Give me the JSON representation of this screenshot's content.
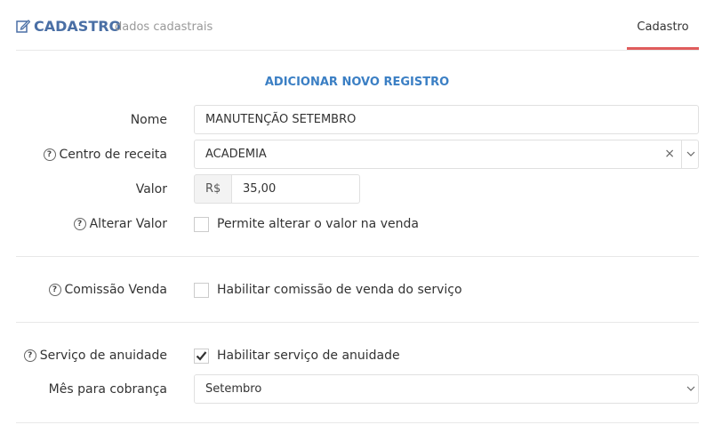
{
  "header": {
    "icon": "edit-icon",
    "title": "CADASTRO",
    "subtitle": "dados cadastrais",
    "tab_label": "Cadastro"
  },
  "colors": {
    "title": "#4a6fa5",
    "section_title": "#3b7fc4",
    "tab_underline": "#e05c5c"
  },
  "form": {
    "section_title": "ADICIONAR NOVO REGISTRO",
    "nome": {
      "label": "Nome",
      "value": "MANUTENÇÃO SETEMBRO"
    },
    "centro_receita": {
      "label": "Centro de receita",
      "value": "ACADEMIA",
      "clear": "×"
    },
    "valor": {
      "label": "Valor",
      "prefix": "R$",
      "value": "35,00"
    },
    "alterar_valor": {
      "label": "Alterar Valor",
      "checkbox_label": "Permite alterar o valor na venda",
      "checked": false
    },
    "comissao": {
      "label": "Comissão Venda",
      "checkbox_label": "Habilitar comissão de venda do serviço",
      "checked": false
    },
    "anuidade": {
      "label": "Serviço de anuidade",
      "checkbox_label": "Habilitar serviço de anuidade",
      "checked": true
    },
    "mes_cobranca": {
      "label": "Mês para cobrança",
      "value": "Setembro"
    }
  }
}
